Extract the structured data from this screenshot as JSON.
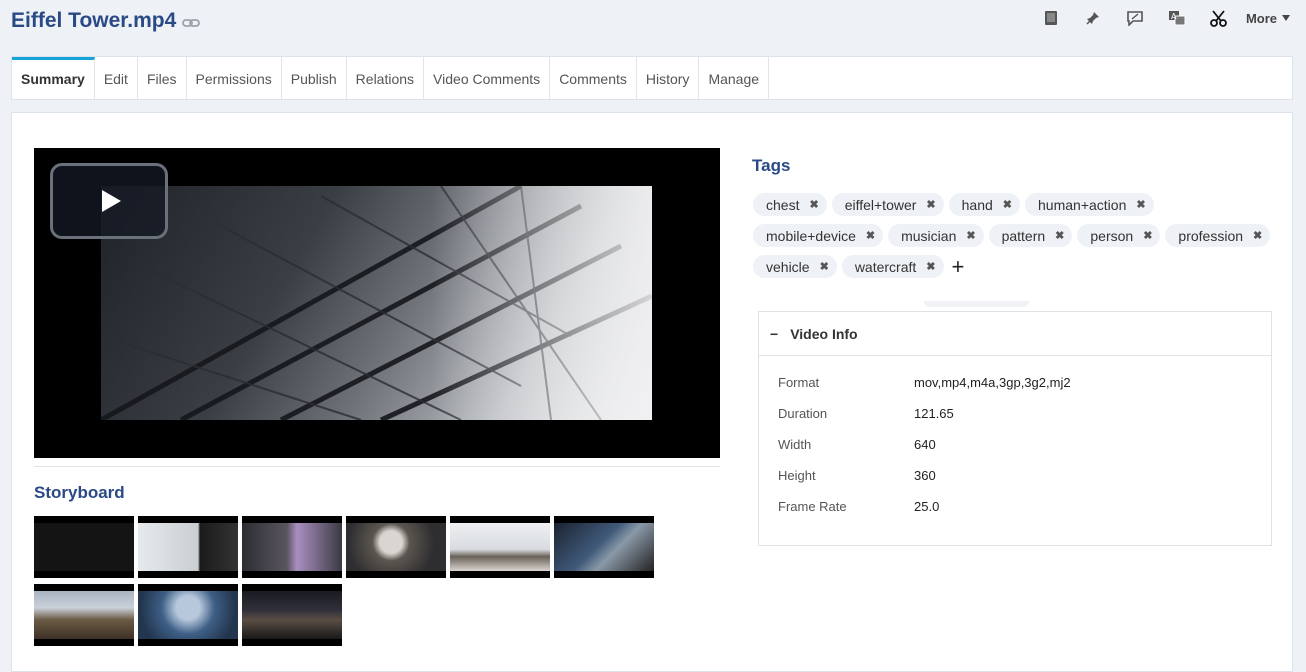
{
  "header": {
    "title": "Eiffel Tower.mp4",
    "more_label": "More",
    "tool_icons": [
      "book-icon",
      "pin-icon",
      "comment-icon",
      "translate-icon",
      "scissors-icon"
    ]
  },
  "tabs": [
    {
      "label": "Summary",
      "active": true
    },
    {
      "label": "Edit"
    },
    {
      "label": "Files"
    },
    {
      "label": "Permissions"
    },
    {
      "label": "Publish"
    },
    {
      "label": "Relations"
    },
    {
      "label": "Video Comments"
    },
    {
      "label": "Comments"
    },
    {
      "label": "History"
    },
    {
      "label": "Manage"
    }
  ],
  "storyboard": {
    "title": "Storyboard",
    "thumb_count": 9
  },
  "tags": {
    "title": "Tags",
    "items": [
      "chest",
      "eiffel+tower",
      "hand",
      "human+action",
      "mobile+device",
      "musician",
      "pattern",
      "person",
      "profession",
      "vehicle",
      "watercraft"
    ],
    "remove_glyph": "✖",
    "add_glyph": "+"
  },
  "video_info": {
    "title": "Video Info",
    "collapse_glyph": "−",
    "rows": [
      {
        "key": "Format",
        "value": "mov,mp4,m4a,3gp,3g2,mj2"
      },
      {
        "key": "Duration",
        "value": "121.65"
      },
      {
        "key": "Width",
        "value": "640"
      },
      {
        "key": "Height",
        "value": "360"
      },
      {
        "key": "Frame Rate",
        "value": "25.0"
      }
    ]
  },
  "colors": {
    "accent": "#15a3d8",
    "title": "#2a4a86"
  }
}
